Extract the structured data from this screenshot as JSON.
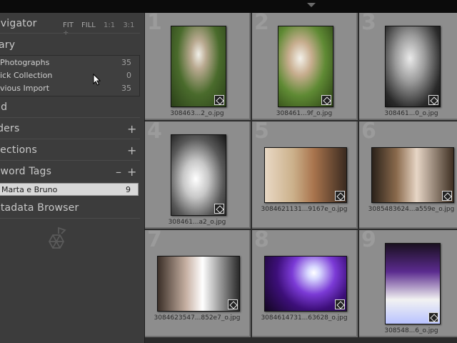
{
  "panel": {
    "navigator": {
      "title": "avigator",
      "options": [
        "FIT",
        "FILL",
        "1:1",
        "3:1 ÷"
      ]
    },
    "library": {
      "title": "rary",
      "rows": [
        {
          "label": " Photographs",
          "count": "35"
        },
        {
          "label": "ick Collection",
          "count": "0"
        },
        {
          "label": "vious Import",
          "count": "35"
        }
      ]
    },
    "find": {
      "title": "nd"
    },
    "folders": {
      "title": "lders",
      "plus": "+"
    },
    "collections": {
      "title": "llections",
      "plus": "+"
    },
    "keyword_tags": {
      "title": "yword Tags",
      "minus": "–",
      "plus": "+",
      "selected": {
        "label": "Marta e Bruno",
        "count": "9"
      }
    },
    "metadata_browser": {
      "title": "etadata Browser"
    }
  },
  "grid": {
    "cells": [
      {
        "num": "1",
        "filename": "308463...2_o.jpg"
      },
      {
        "num": "2",
        "filename": "308461...9f_o.jpg"
      },
      {
        "num": "3",
        "filename": "308461...0_o.jpg"
      },
      {
        "num": "4",
        "filename": "308461...a2_o.jpg"
      },
      {
        "num": "5",
        "filename": "3084621131...9167e_o.jpg"
      },
      {
        "num": "6",
        "filename": "3085483624...a559e_o.jpg"
      },
      {
        "num": "7",
        "filename": "3084623547...852e7_o.jpg"
      },
      {
        "num": "8",
        "filename": "3084614731...63628_o.jpg"
      },
      {
        "num": "9",
        "filename": "308548...6_o.jpg"
      }
    ]
  }
}
